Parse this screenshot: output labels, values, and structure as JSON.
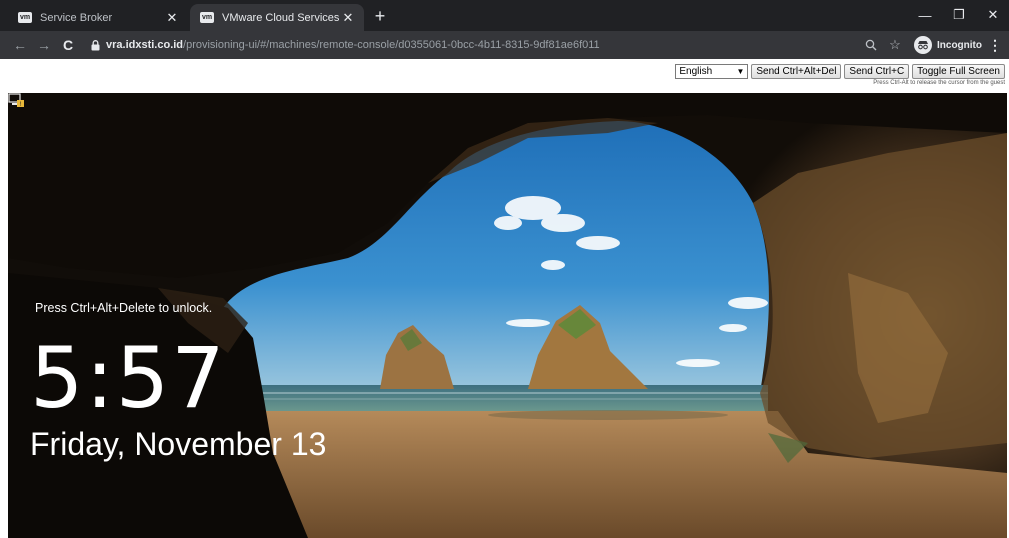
{
  "browser": {
    "tabs": [
      {
        "favicon": "vm",
        "title": "Service Broker",
        "active": false
      },
      {
        "favicon": "vm",
        "title": "VMware Cloud Services",
        "active": true
      }
    ],
    "new_tab_icon": "plus-icon",
    "window_controls": [
      "minimize-icon",
      "restore-icon",
      "close-icon"
    ],
    "address": {
      "host": "vra.idxsti.co.id",
      "path": "/provisioning-ui/#/machines/remote-console/d0355061-0bcc-4b11-8315-9df81ae6f011"
    },
    "profile_label": "Incognito"
  },
  "console_controls": {
    "language_selected": "English",
    "send_ctrl_alt_del": "Send Ctrl+Alt+Del",
    "send_ctrl_c": "Send Ctrl+C",
    "toggle_full_screen": "Toggle Full Screen",
    "hint": "Press Ctrl-Alt to release the cursor from the guest"
  },
  "lock_screen": {
    "unlock_prompt": "Press Ctrl+Alt+Delete to unlock.",
    "time": "5:57",
    "date": "Friday, November 13"
  },
  "colors": {
    "tab_strip": "#202124",
    "toolbar": "#35363a",
    "sky": "#2f86c9",
    "sea": "#4b7e86",
    "sand": "#c08e55",
    "rock": "#3a2a18"
  }
}
